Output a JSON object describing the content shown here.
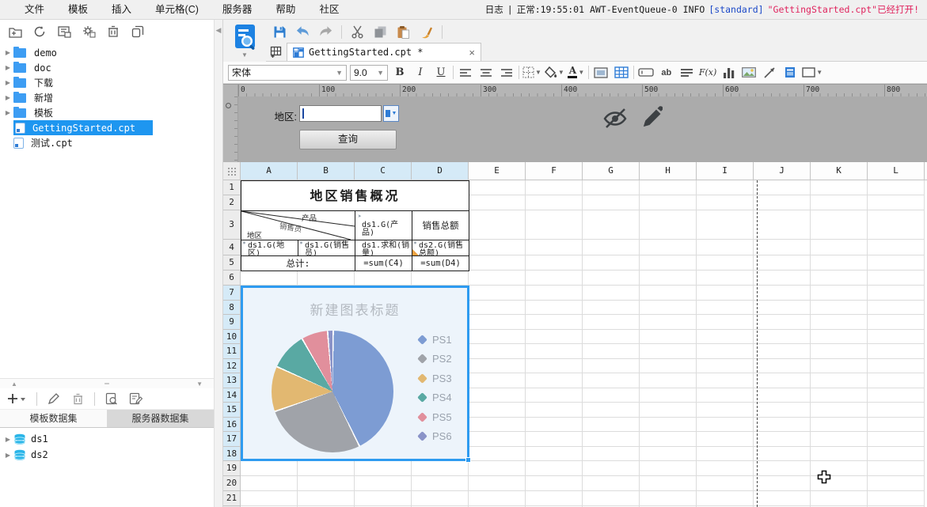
{
  "menubar": {
    "items": [
      "文件",
      "模板",
      "插入",
      "单元格(C)",
      "服务器",
      "帮助",
      "社区"
    ]
  },
  "logbar": {
    "label": "日志",
    "separator": "|",
    "info": "正常:19:55:01 AWT-EventQueue-0 INFO",
    "tag": "[standard]",
    "message": "\"GettingStarted.cpt\"已经打开!"
  },
  "left_panel": {
    "toolbar_icons": [
      "new-folder",
      "refresh",
      "locate-template",
      "install-plugin",
      "delete",
      "copy"
    ],
    "tree": [
      {
        "label": "demo",
        "type": "folder"
      },
      {
        "label": "doc",
        "type": "folder"
      },
      {
        "label": "下载",
        "type": "folder"
      },
      {
        "label": "新增",
        "type": "folder"
      },
      {
        "label": "模板",
        "type": "folder"
      },
      {
        "label": "GettingStarted.cpt",
        "type": "file",
        "selected": true
      },
      {
        "label": "测试.cpt",
        "type": "file"
      }
    ],
    "splitter_icons": [
      "collapse-up",
      "equals",
      "collapse-down"
    ],
    "dataset": {
      "toolbar_icons": [
        "add",
        "edit",
        "delete",
        "preview",
        "batch-edit"
      ],
      "tabs": [
        {
          "label": "模板数据集",
          "active": true
        },
        {
          "label": "服务器数据集",
          "active": false
        }
      ],
      "items": [
        "ds1",
        "ds2"
      ]
    }
  },
  "quick_toolbar_icons": [
    "preview",
    "save",
    "undo",
    "redo",
    "cut",
    "copy",
    "paste",
    "format-painter"
  ],
  "tabbar": {
    "tab_title": "GettingStarted.cpt *",
    "close_glyph": "×"
  },
  "format_toolbar": {
    "font_family": "宋体",
    "font_size": "9.0",
    "bold": "B",
    "italic": "I",
    "underline": "U",
    "ab_label": "ab",
    "formula_label": "F(x)"
  },
  "ruler": {
    "ticks": [
      "0",
      "100",
      "200",
      "300",
      "400",
      "500",
      "600",
      "700",
      "800"
    ]
  },
  "param_pane": {
    "field_label": "地区:",
    "query_button": "查询"
  },
  "sheet": {
    "columns": [
      {
        "label": "A",
        "selected": true
      },
      {
        "label": "B",
        "selected": true
      },
      {
        "label": "C",
        "selected": true
      },
      {
        "label": "D",
        "selected": true
      },
      {
        "label": "E"
      },
      {
        "label": "F"
      },
      {
        "label": "G"
      },
      {
        "label": "H"
      },
      {
        "label": "I"
      },
      {
        "label": "J"
      },
      {
        "label": "K"
      },
      {
        "label": "L"
      }
    ],
    "rows": [
      {
        "label": "1"
      },
      {
        "label": "2"
      },
      {
        "label": "3"
      },
      {
        "label": "4"
      },
      {
        "label": "5"
      },
      {
        "label": "6"
      },
      {
        "label": "7",
        "selected": true
      },
      {
        "label": "8",
        "selected": true
      },
      {
        "label": "9",
        "selected": true
      },
      {
        "label": "10",
        "selected": true
      },
      {
        "label": "11",
        "selected": true
      },
      {
        "label": "12",
        "selected": true
      },
      {
        "label": "13",
        "selected": true
      },
      {
        "label": "14",
        "selected": true
      },
      {
        "label": "15",
        "selected": true
      },
      {
        "label": "16",
        "selected": true
      },
      {
        "label": "17",
        "selected": true
      },
      {
        "label": "18",
        "selected": true
      },
      {
        "label": "19"
      },
      {
        "label": "20"
      },
      {
        "label": "21"
      }
    ]
  },
  "report": {
    "title": "地区销售概况",
    "diagonal": {
      "top_label": "产品",
      "middle_label": "销售员",
      "bottom_label": "地区"
    },
    "cells": {
      "c3": "ds1.G(产品)",
      "d3": "销售总额",
      "a4": "ds1.G(地区)",
      "b4": "ds1.G(销售员)",
      "c4": "ds1.求和(销量)",
      "d4": "ds2.G(销售总额)",
      "a5": "总计:",
      "c5": "=sum(C4)",
      "d5": "=sum(D4)"
    }
  },
  "chart_data": {
    "type": "pie",
    "title": "新建图表标题",
    "title_color": "#b3b9c0",
    "legend_position": "right",
    "series": [
      {
        "name": "PS1",
        "value": 42.5,
        "color": "#7d9cd3"
      },
      {
        "name": "PS2",
        "value": 27.0,
        "color": "#a0a3a9"
      },
      {
        "name": "PS3",
        "value": 12.0,
        "color": "#e2b871"
      },
      {
        "name": "PS4",
        "value": 10.0,
        "color": "#59a9a3"
      },
      {
        "name": "PS5",
        "value": 7.0,
        "color": "#e18f9c"
      },
      {
        "name": "PS6",
        "value": 1.5,
        "color": "#8a93c8"
      }
    ]
  }
}
